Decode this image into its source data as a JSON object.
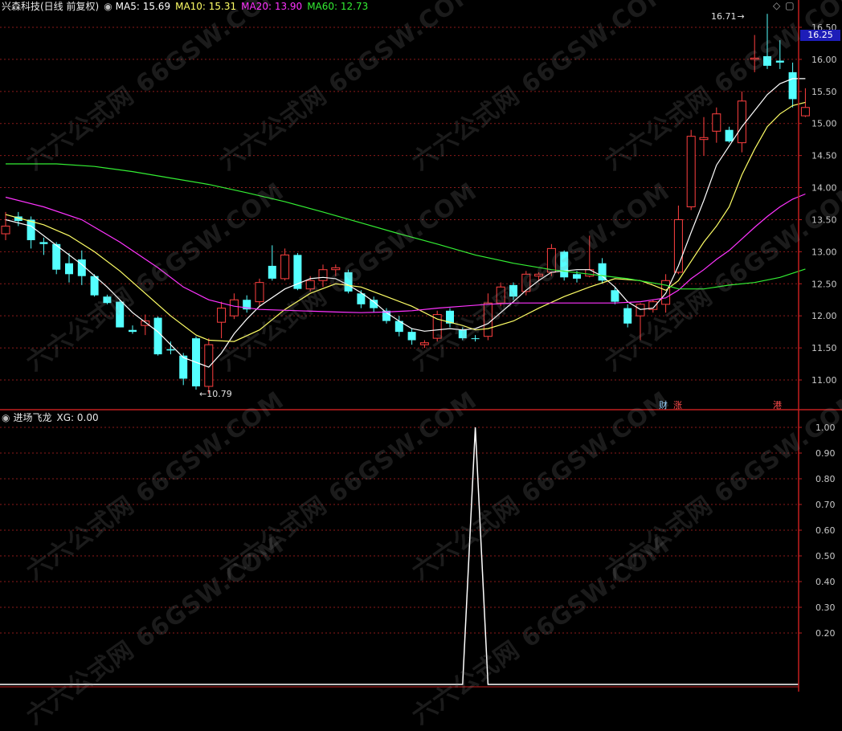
{
  "colors": {
    "up": "#ff4040",
    "down": "#54ffff",
    "ma5": "#ffffff",
    "ma10": "#ffff66",
    "ma20": "#ff33ff",
    "ma60": "#33ee33",
    "grid": "#8b1a1a",
    "axis": "#c21f1f",
    "price_box_bg": "#1d1db8"
  },
  "header": {
    "title": "兴森科技(日线 前复权)",
    "ma5": "MA5: 15.69",
    "ma10": "MA10: 15.31",
    "ma20": "MA20: 13.90",
    "ma60": "MA60: 12.73"
  },
  "sub_header": {
    "title": "进场飞龙",
    "xg": "XG: 0.00"
  },
  "current_price": "16.25",
  "annotations": {
    "high": "16.71",
    "low": "10.79"
  },
  "event_tags": [
    "财",
    "涨",
    "港"
  ],
  "watermark": "六六公式网 66GSW.COM",
  "chart_data": [
    {
      "type": "candlestick",
      "y_ticks": [
        "16.50",
        "16.00",
        "15.50",
        "15.00",
        "14.50",
        "14.00",
        "13.50",
        "13.00",
        "12.50",
        "12.00",
        "11.50",
        "11.00"
      ],
      "ylim": [
        10.65,
        16.75
      ],
      "candles": [
        {
          "o": 13.28,
          "h": 13.62,
          "l": 13.18,
          "c": 13.4
        },
        {
          "o": 13.55,
          "h": 13.62,
          "l": 13.4,
          "c": 13.48
        },
        {
          "o": 13.5,
          "h": 13.55,
          "l": 13.05,
          "c": 13.18
        },
        {
          "o": 13.15,
          "h": 13.22,
          "l": 12.95,
          "c": 13.12
        },
        {
          "o": 13.12,
          "h": 13.15,
          "l": 12.65,
          "c": 12.72
        },
        {
          "o": 12.82,
          "h": 12.98,
          "l": 12.52,
          "c": 12.65
        },
        {
          "o": 12.88,
          "h": 13.02,
          "l": 12.48,
          "c": 12.62
        },
        {
          "o": 12.62,
          "h": 12.65,
          "l": 12.3,
          "c": 12.32
        },
        {
          "o": 12.3,
          "h": 12.33,
          "l": 12.18,
          "c": 12.2
        },
        {
          "o": 12.22,
          "h": 12.25,
          "l": 11.82,
          "c": 11.82
        },
        {
          "o": 11.78,
          "h": 11.85,
          "l": 11.72,
          "c": 11.75
        },
        {
          "o": 11.85,
          "h": 12.02,
          "l": 11.7,
          "c": 11.92
        },
        {
          "o": 11.97,
          "h": 11.99,
          "l": 11.38,
          "c": 11.4
        },
        {
          "o": 11.48,
          "h": 11.6,
          "l": 11.4,
          "c": 11.46
        },
        {
          "o": 11.38,
          "h": 11.42,
          "l": 10.92,
          "c": 11.02
        },
        {
          "o": 11.65,
          "h": 11.68,
          "l": 10.85,
          "c": 10.9
        },
        {
          "o": 10.9,
          "h": 11.65,
          "l": 10.79,
          "c": 11.55
        },
        {
          "o": 11.9,
          "h": 12.22,
          "l": 11.65,
          "c": 12.12
        },
        {
          "o": 12.0,
          "h": 12.35,
          "l": 11.95,
          "c": 12.25
        },
        {
          "o": 12.25,
          "h": 12.32,
          "l": 12.05,
          "c": 12.1
        },
        {
          "o": 12.22,
          "h": 12.58,
          "l": 12.15,
          "c": 12.52
        },
        {
          "o": 12.78,
          "h": 13.1,
          "l": 12.55,
          "c": 12.58
        },
        {
          "o": 12.58,
          "h": 13.05,
          "l": 12.55,
          "c": 12.95
        },
        {
          "o": 12.95,
          "h": 12.98,
          "l": 12.4,
          "c": 12.42
        },
        {
          "o": 12.42,
          "h": 12.62,
          "l": 12.38,
          "c": 12.55
        },
        {
          "o": 12.55,
          "h": 12.8,
          "l": 12.45,
          "c": 12.72
        },
        {
          "o": 12.72,
          "h": 12.8,
          "l": 12.62,
          "c": 12.75
        },
        {
          "o": 12.68,
          "h": 12.72,
          "l": 12.35,
          "c": 12.38
        },
        {
          "o": 12.35,
          "h": 12.4,
          "l": 12.12,
          "c": 12.18
        },
        {
          "o": 12.25,
          "h": 12.3,
          "l": 12.05,
          "c": 12.12
        },
        {
          "o": 12.08,
          "h": 12.12,
          "l": 11.88,
          "c": 11.92
        },
        {
          "o": 11.92,
          "h": 12.0,
          "l": 11.68,
          "c": 11.75
        },
        {
          "o": 11.75,
          "h": 11.8,
          "l": 11.55,
          "c": 11.62
        },
        {
          "o": 11.55,
          "h": 11.62,
          "l": 11.5,
          "c": 11.58
        },
        {
          "o": 11.65,
          "h": 12.08,
          "l": 11.6,
          "c": 12.02
        },
        {
          "o": 12.08,
          "h": 12.12,
          "l": 11.82,
          "c": 11.88
        },
        {
          "o": 11.78,
          "h": 11.82,
          "l": 11.62,
          "c": 11.65
        },
        {
          "o": 11.65,
          "h": 11.7,
          "l": 11.6,
          "c": 11.64
        },
        {
          "o": 11.68,
          "h": 12.35,
          "l": 11.62,
          "c": 12.2
        },
        {
          "o": 12.2,
          "h": 12.52,
          "l": 12.15,
          "c": 12.45
        },
        {
          "o": 12.48,
          "h": 12.52,
          "l": 12.25,
          "c": 12.3
        },
        {
          "o": 12.38,
          "h": 12.7,
          "l": 12.32,
          "c": 12.65
        },
        {
          "o": 12.62,
          "h": 12.68,
          "l": 12.55,
          "c": 12.65
        },
        {
          "o": 12.68,
          "h": 13.12,
          "l": 12.62,
          "c": 13.05
        },
        {
          "o": 13.0,
          "h": 13.02,
          "l": 12.55,
          "c": 12.6
        },
        {
          "o": 12.65,
          "h": 12.7,
          "l": 12.52,
          "c": 12.58
        },
        {
          "o": 12.62,
          "h": 13.25,
          "l": 12.6,
          "c": 12.72
        },
        {
          "o": 12.82,
          "h": 12.9,
          "l": 12.5,
          "c": 12.55
        },
        {
          "o": 12.4,
          "h": 12.45,
          "l": 12.18,
          "c": 12.22
        },
        {
          "o": 12.12,
          "h": 12.18,
          "l": 11.82,
          "c": 11.88
        },
        {
          "o": 12.0,
          "h": 12.2,
          "l": 11.62,
          "c": 12.18
        },
        {
          "o": 12.1,
          "h": 12.25,
          "l": 12.05,
          "c": 12.22
        },
        {
          "o": 12.18,
          "h": 12.65,
          "l": 12.05,
          "c": 12.55
        },
        {
          "o": 12.68,
          "h": 13.72,
          "l": 12.65,
          "c": 13.5
        },
        {
          "o": 13.7,
          "h": 14.9,
          "l": 13.65,
          "c": 14.8
        },
        {
          "o": 14.75,
          "h": 15.1,
          "l": 14.5,
          "c": 14.78
        },
        {
          "o": 14.88,
          "h": 15.25,
          "l": 14.7,
          "c": 15.15
        },
        {
          "o": 14.9,
          "h": 14.95,
          "l": 14.7,
          "c": 14.72
        },
        {
          "o": 14.7,
          "h": 15.5,
          "l": 14.55,
          "c": 15.35
        },
        {
          "o": 16.0,
          "h": 16.38,
          "l": 15.8,
          "c": 16.02
        },
        {
          "o": 16.05,
          "h": 16.71,
          "l": 15.85,
          "c": 15.9
        },
        {
          "o": 15.98,
          "h": 16.3,
          "l": 15.85,
          "c": 15.95
        },
        {
          "o": 15.8,
          "h": 15.95,
          "l": 15.25,
          "c": 15.38
        },
        {
          "o": 15.12,
          "h": 15.55,
          "l": 15.1,
          "c": 15.25
        }
      ],
      "ma_series": [
        {
          "name": "MA5",
          "color": "ma5",
          "points": [
            [
              0,
              13.5
            ],
            [
              2,
              13.4
            ],
            [
              4,
              13.1
            ],
            [
              6,
              12.8
            ],
            [
              8,
              12.45
            ],
            [
              10,
              12.05
            ],
            [
              12,
              11.75
            ],
            [
              14,
              11.35
            ],
            [
              16,
              11.2
            ],
            [
              17,
              11.42
            ],
            [
              18,
              11.72
            ],
            [
              19,
              11.95
            ],
            [
              20,
              12.15
            ],
            [
              22,
              12.42
            ],
            [
              24,
              12.58
            ],
            [
              25,
              12.6
            ],
            [
              26,
              12.58
            ],
            [
              27,
              12.48
            ],
            [
              28,
              12.36
            ],
            [
              29,
              12.22
            ],
            [
              30,
              12.05
            ],
            [
              31,
              11.92
            ],
            [
              32,
              11.8
            ],
            [
              33,
              11.76
            ],
            [
              34,
              11.78
            ],
            [
              35,
              11.8
            ],
            [
              36,
              11.78
            ],
            [
              37,
              11.8
            ],
            [
              38,
              11.88
            ],
            [
              39,
              12.05
            ],
            [
              40,
              12.22
            ],
            [
              41,
              12.4
            ],
            [
              42,
              12.55
            ],
            [
              43,
              12.68
            ],
            [
              44,
              12.7
            ],
            [
              45,
              12.72
            ],
            [
              46,
              12.72
            ],
            [
              47,
              12.62
            ],
            [
              48,
              12.45
            ],
            [
              49,
              12.22
            ],
            [
              50,
              12.1
            ],
            [
              51,
              12.12
            ],
            [
              52,
              12.35
            ],
            [
              53,
              12.78
            ],
            [
              54,
              13.3
            ],
            [
              55,
              13.8
            ],
            [
              56,
              14.35
            ],
            [
              57,
              14.65
            ],
            [
              58,
              14.95
            ],
            [
              59,
              15.2
            ],
            [
              60,
              15.45
            ],
            [
              61,
              15.62
            ],
            [
              62,
              15.7
            ],
            [
              63,
              15.7
            ]
          ]
        },
        {
          "name": "MA10",
          "color": "ma10",
          "points": [
            [
              0,
              13.58
            ],
            [
              3,
              13.42
            ],
            [
              5,
              13.25
            ],
            [
              7,
              13.0
            ],
            [
              9,
              12.7
            ],
            [
              11,
              12.35
            ],
            [
              13,
              12.0
            ],
            [
              15,
              11.7
            ],
            [
              16,
              11.62
            ],
            [
              18,
              11.6
            ],
            [
              20,
              11.78
            ],
            [
              22,
              12.1
            ],
            [
              24,
              12.35
            ],
            [
              26,
              12.5
            ],
            [
              28,
              12.45
            ],
            [
              30,
              12.3
            ],
            [
              32,
              12.15
            ],
            [
              34,
              11.95
            ],
            [
              36,
              11.85
            ],
            [
              37,
              11.78
            ],
            [
              38,
              11.8
            ],
            [
              40,
              11.92
            ],
            [
              42,
              12.12
            ],
            [
              44,
              12.3
            ],
            [
              46,
              12.45
            ],
            [
              48,
              12.58
            ],
            [
              50,
              12.55
            ],
            [
              51,
              12.48
            ],
            [
              52,
              12.4
            ],
            [
              53,
              12.55
            ],
            [
              54,
              12.85
            ],
            [
              55,
              13.15
            ],
            [
              56,
              13.4
            ],
            [
              57,
              13.7
            ],
            [
              58,
              14.2
            ],
            [
              59,
              14.6
            ],
            [
              60,
              14.95
            ],
            [
              61,
              15.15
            ],
            [
              62,
              15.28
            ],
            [
              63,
              15.33
            ]
          ]
        },
        {
          "name": "MA20",
          "color": "ma20",
          "points": [
            [
              0,
              13.85
            ],
            [
              3,
              13.7
            ],
            [
              6,
              13.5
            ],
            [
              9,
              13.15
            ],
            [
              12,
              12.75
            ],
            [
              14,
              12.45
            ],
            [
              16,
              12.25
            ],
            [
              18,
              12.15
            ],
            [
              20,
              12.1
            ],
            [
              23,
              12.08
            ],
            [
              26,
              12.06
            ],
            [
              28,
              12.05
            ],
            [
              30,
              12.06
            ],
            [
              32,
              12.08
            ],
            [
              34,
              12.12
            ],
            [
              36,
              12.15
            ],
            [
              38,
              12.18
            ],
            [
              40,
              12.2
            ],
            [
              44,
              12.2
            ],
            [
              48,
              12.2
            ],
            [
              50,
              12.22
            ],
            [
              52,
              12.28
            ],
            [
              53,
              12.4
            ],
            [
              54,
              12.58
            ],
            [
              55,
              12.72
            ],
            [
              56,
              12.88
            ],
            [
              57,
              13.02
            ],
            [
              58,
              13.2
            ],
            [
              59,
              13.38
            ],
            [
              60,
              13.55
            ],
            [
              61,
              13.7
            ],
            [
              62,
              13.82
            ],
            [
              63,
              13.9
            ]
          ]
        },
        {
          "name": "MA60",
          "color": "ma60",
          "points": [
            [
              0,
              14.37
            ],
            [
              4,
              14.37
            ],
            [
              7,
              14.33
            ],
            [
              10,
              14.25
            ],
            [
              13,
              14.15
            ],
            [
              16,
              14.05
            ],
            [
              19,
              13.92
            ],
            [
              22,
              13.78
            ],
            [
              25,
              13.62
            ],
            [
              28,
              13.45
            ],
            [
              31,
              13.28
            ],
            [
              34,
              13.12
            ],
            [
              37,
              12.95
            ],
            [
              40,
              12.82
            ],
            [
              43,
              12.72
            ],
            [
              46,
              12.65
            ],
            [
              49,
              12.58
            ],
            [
              52,
              12.48
            ],
            [
              53,
              12.42
            ],
            [
              55,
              12.42
            ],
            [
              57,
              12.48
            ],
            [
              59,
              12.52
            ],
            [
              61,
              12.6
            ],
            [
              63,
              12.73
            ]
          ]
        }
      ]
    },
    {
      "type": "line",
      "title": "进场飞龙",
      "series": [
        {
          "name": "XG",
          "values": [
            [
              0,
              0
            ],
            [
              36,
              0
            ],
            [
              37,
              1
            ],
            [
              38,
              0
            ],
            [
              63,
              0
            ]
          ]
        }
      ],
      "y_ticks": [
        "1.00",
        "0.90",
        "0.80",
        "0.70",
        "0.60",
        "0.50",
        "0.40",
        "0.30",
        "0.20"
      ],
      "ylim": [
        0,
        1.03
      ]
    }
  ]
}
